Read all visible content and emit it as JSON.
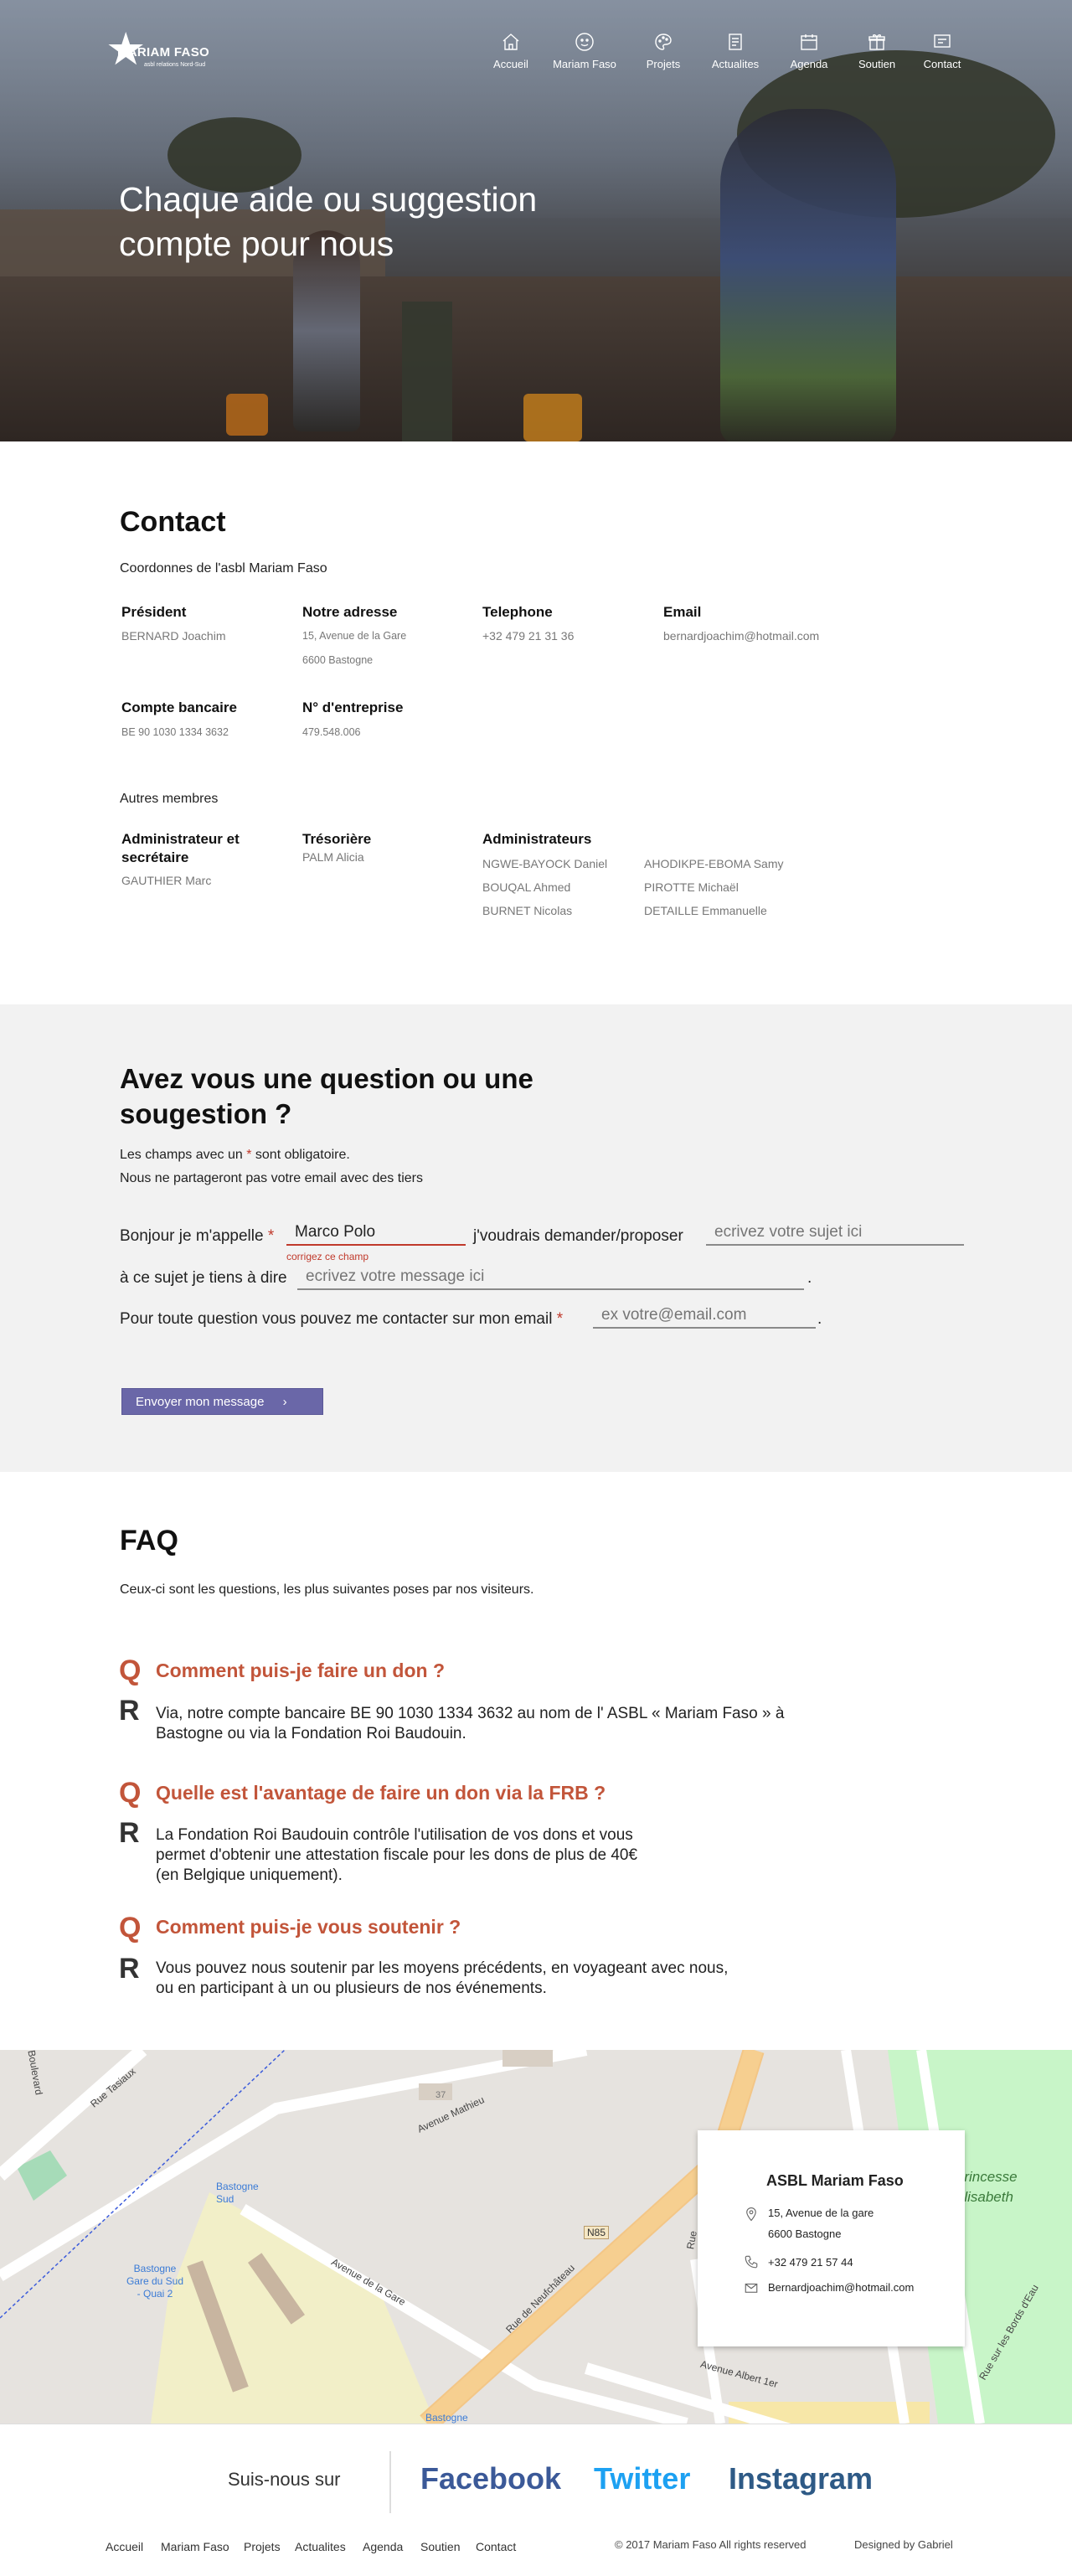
{
  "logo": {
    "name": "MARIAM FASO",
    "tagline": "asbl relations Nord-Sud"
  },
  "nav": [
    {
      "label": "Accueil",
      "icon": "home-icon"
    },
    {
      "label": "Mariam Faso",
      "icon": "smiley-icon"
    },
    {
      "label": "Projets",
      "icon": "palette-icon"
    },
    {
      "label": "Actualites",
      "icon": "document-icon"
    },
    {
      "label": "Agenda",
      "icon": "calendar-icon"
    },
    {
      "label": "Soutien",
      "icon": "gift-icon"
    },
    {
      "label": "Contact",
      "icon": "screen-icon"
    }
  ],
  "hero": {
    "title": "Chaque aide ou suggestion compte pour nous"
  },
  "contact": {
    "title": "Contact",
    "subtitle": "Coordonnes de l'asbl Mariam Faso",
    "president_label": "Président",
    "president_value": "BERNARD Joachim",
    "address_label": "Notre adresse",
    "address_line1": "15, Avenue de la Gare",
    "address_line2": "6600 Bastogne",
    "phone_label": "Telephone",
    "phone_value": "+32 479 21 31 36",
    "email_label": "Email",
    "email_value": "bernardjoachim@hotmail.com",
    "bank_label": "Compte bancaire",
    "bank_value": "BE 90 1030 1334 3632",
    "company_label": "N° d'entreprise",
    "company_value": "479.548.006",
    "others_title": "Autres membres",
    "admin_sec_label": "Administrateur et secrétaire",
    "admin_sec_value": "GAUTHIER Marc",
    "treasurer_label": "Trésorière",
    "treasurer_value": "PALM Alicia",
    "admins_label": "Administrateurs",
    "admins": [
      "NGWE-BAYOCK Daniel",
      "BOUQAL Ahmed",
      "BURNET Nicolas",
      "AHODIKPE-EBOMA Samy",
      "PIROTTE Michaël",
      "DETAILLE Emmanuelle"
    ]
  },
  "form": {
    "title": "Avez vous une question ou une sougestion ?",
    "note1_before": "Les champs avec un",
    "note1_star": "*",
    "note1_after": "sont obligatoire.",
    "note2": "Nous ne partageront pas votre email avec des tiers",
    "line1_before": "Bonjour je m'appelle",
    "name_value": "Marco Polo",
    "name_error": "corrigez ce champ",
    "line1_middle": "j'voudrais demander/proposer",
    "subject_placeholder": "ecrivez votre sujet ici",
    "line2_before": "à ce sujet je tiens à dire",
    "message_placeholder": "ecrivez votre message ici",
    "line3_before": "Pour toute question vous pouvez me contacter sur mon email",
    "email_placeholder": "ex votre@email.com",
    "period": ".",
    "star": "*",
    "send_label": "Envoyer mon message",
    "send_arrow": "›"
  },
  "faq": {
    "title": "FAQ",
    "intro": "Ceux-ci sont les questions, les plus suivantes poses par nos visiteurs.",
    "q_letter": "Q",
    "r_letter": "R",
    "items": [
      {
        "q": "Comment puis-je faire un don ?",
        "r": "Via, notre compte bancaire BE 90 1030 1334 3632 au nom de l' ASBL « Mariam Faso » à Bastogne ou via la Fondation Roi Baudouin."
      },
      {
        "q": "Quelle est l'avantage de faire un don via la FRB ?",
        "r": "La Fondation Roi Baudouin contrôle l'utilisation de vos dons et vous permet d'obtenir une attestation fiscale pour les dons de plus de 40€ (en Belgique uniquement)."
      },
      {
        "q": "Comment puis-je vous soutenir ?",
        "r": "Vous pouvez nous soutenir par les moyens précédents, en voyageant avec nous,  ou en participant à un ou plusieurs de nos événements."
      }
    ]
  },
  "map": {
    "streets": [
      "Rue Tasiaux",
      "Avenue Mathieu",
      "Avenue de la Gare",
      "Rue de Neufchâteau",
      "Avenue Albert 1er",
      "Rue sur les Bords d'Eau",
      "Boulevard",
      "Rue"
    ],
    "labels": [
      "Bastogne Gare du Sud - Quai 2",
      "Bastogne Sud",
      "Bastogne",
      "Princesse Elisabeth",
      "N85",
      "37"
    ],
    "card_title": "ASBL Mariam Faso",
    "card_address1": "15, Avenue de la gare",
    "card_address2": "6600 Bastogne",
    "card_phone": "+32 479 21 57 44",
    "card_email": "Bernardjoachim@hotmail.com"
  },
  "footer": {
    "follow": "Suis-nous sur",
    "facebook": "Facebook",
    "twitter": "Twitter",
    "instagram": "Instagram",
    "links": [
      "Accueil",
      "Mariam Faso",
      "Projets",
      "Actualites",
      "Agenda",
      "Soutien",
      "Contact"
    ],
    "copyright": "© 2017 Mariam Faso All rights reserved",
    "credit": "Designed by Gabriel"
  },
  "colors": {
    "accent": "#c2553a",
    "button": "#6a67a8",
    "facebook": "#3b5998",
    "twitter": "#1da1f2",
    "instagram": "#2e5a86"
  }
}
